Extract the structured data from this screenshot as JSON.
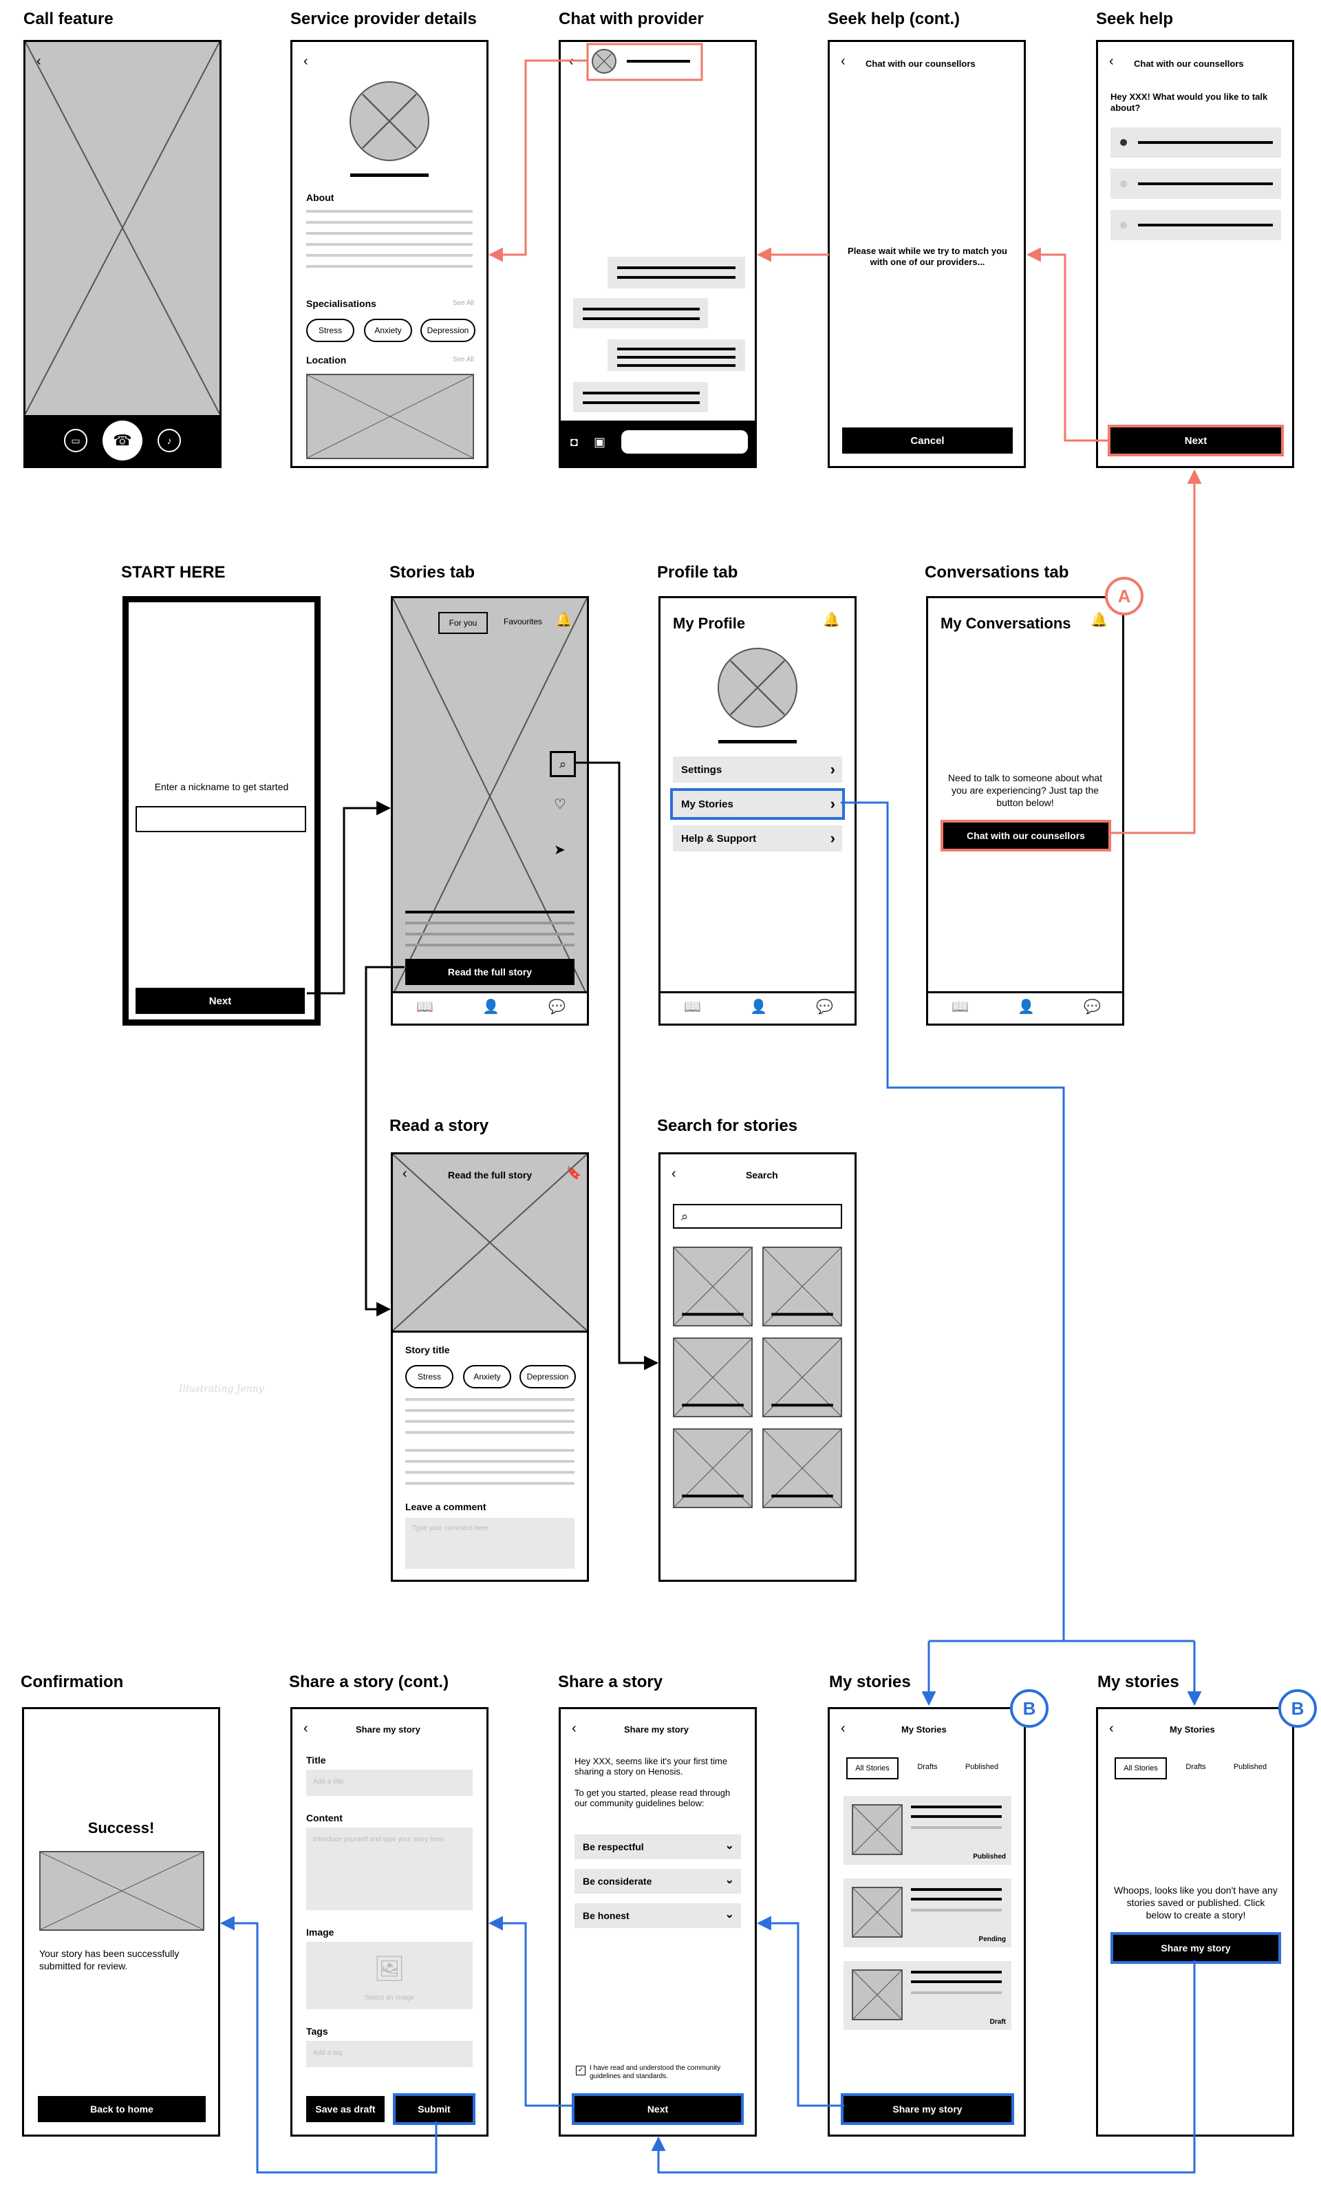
{
  "titles": {
    "call": "Call feature",
    "provider": "Service provider details",
    "chat": "Chat with provider",
    "seek2": "Seek help (cont.)",
    "seek": "Seek help",
    "start": "START HERE",
    "stories": "Stories tab",
    "profile": "Profile tab",
    "conv": "Conversations tab",
    "read": "Read a story",
    "search": "Search for stories",
    "confirm": "Confirmation",
    "share2": "Share a story (cont.)",
    "share": "Share a story",
    "mystories1": "My stories",
    "mystories2": "My stories"
  },
  "provider": {
    "about": "About",
    "specialisations": "Specialisations",
    "see_all": "See All",
    "location": "Location",
    "tags": [
      "Stress",
      "Anxiety",
      "Depression"
    ]
  },
  "seek2": {
    "header": "Chat with our counsellors",
    "wait": "Please wait while we try to match you with one of our providers...",
    "cancel": "Cancel"
  },
  "seek": {
    "header": "Chat with our counsellors",
    "question": "Hey XXX! What would you like to talk about?",
    "next": "Next"
  },
  "start": {
    "prompt": "Enter a nickname to get started",
    "next": "Next"
  },
  "stories": {
    "tab_for_you": "For you",
    "tab_favourites": "Favourites",
    "read_full": "Read the full story"
  },
  "profile": {
    "title": "My Profile",
    "items": [
      "Settings",
      "My Stories",
      "Help & Support"
    ]
  },
  "conv": {
    "title": "My Conversations",
    "message": "Need to talk to someone about what you are experiencing? Just tap the button below!",
    "button": "Chat with our counsellors"
  },
  "read": {
    "header": "Read the full story",
    "story_title": "Story title",
    "tags": [
      "Stress",
      "Anxiety",
      "Depression"
    ],
    "comment_label": "Leave a comment",
    "comment_placeholder": "Type your comment here",
    "watermark": "Illustrating Jenny"
  },
  "search": {
    "header": "Search"
  },
  "confirm": {
    "success": "Success!",
    "message": "Your story has been successfully submitted for review.",
    "button": "Back to home"
  },
  "share2": {
    "header": "Share my story",
    "title_label": "Title",
    "title_placeholder": "Add a title",
    "content_label": "Content",
    "content_placeholder": "Introduce yourself and type your story here",
    "image_label": "Image",
    "image_placeholder": "Select an image",
    "tags_label": "Tags",
    "tags_placeholder": "Add a tag",
    "draft": "Save as draft",
    "submit": "Submit"
  },
  "share": {
    "header": "Share my story",
    "intro1": "Hey XXX, seems like it's your first time sharing a story on Henosis.",
    "intro2": "To get you started, please read through our community guidelines below:",
    "rules": [
      "Be respectful",
      "Be considerate",
      "Be honest"
    ],
    "agree": "I have read and understood the community guidelines and standards.",
    "next": "Next"
  },
  "mystories1": {
    "header": "My Stories",
    "tabs": [
      "All Stories",
      "Drafts",
      "Published"
    ],
    "statuses": [
      "Published",
      "Pending",
      "Draft"
    ],
    "button": "Share my story"
  },
  "mystories2": {
    "header": "My Stories",
    "tabs": [
      "All Stories",
      "Drafts",
      "Published"
    ],
    "empty": "Whoops, looks like you don't have any stories saved or published. Click below to create a story!",
    "button": "Share my story"
  },
  "badges": {
    "a": "A",
    "b1": "B",
    "b2": "B"
  },
  "colors": {
    "red": "#f0786a",
    "blue": "#2a6fdb"
  }
}
